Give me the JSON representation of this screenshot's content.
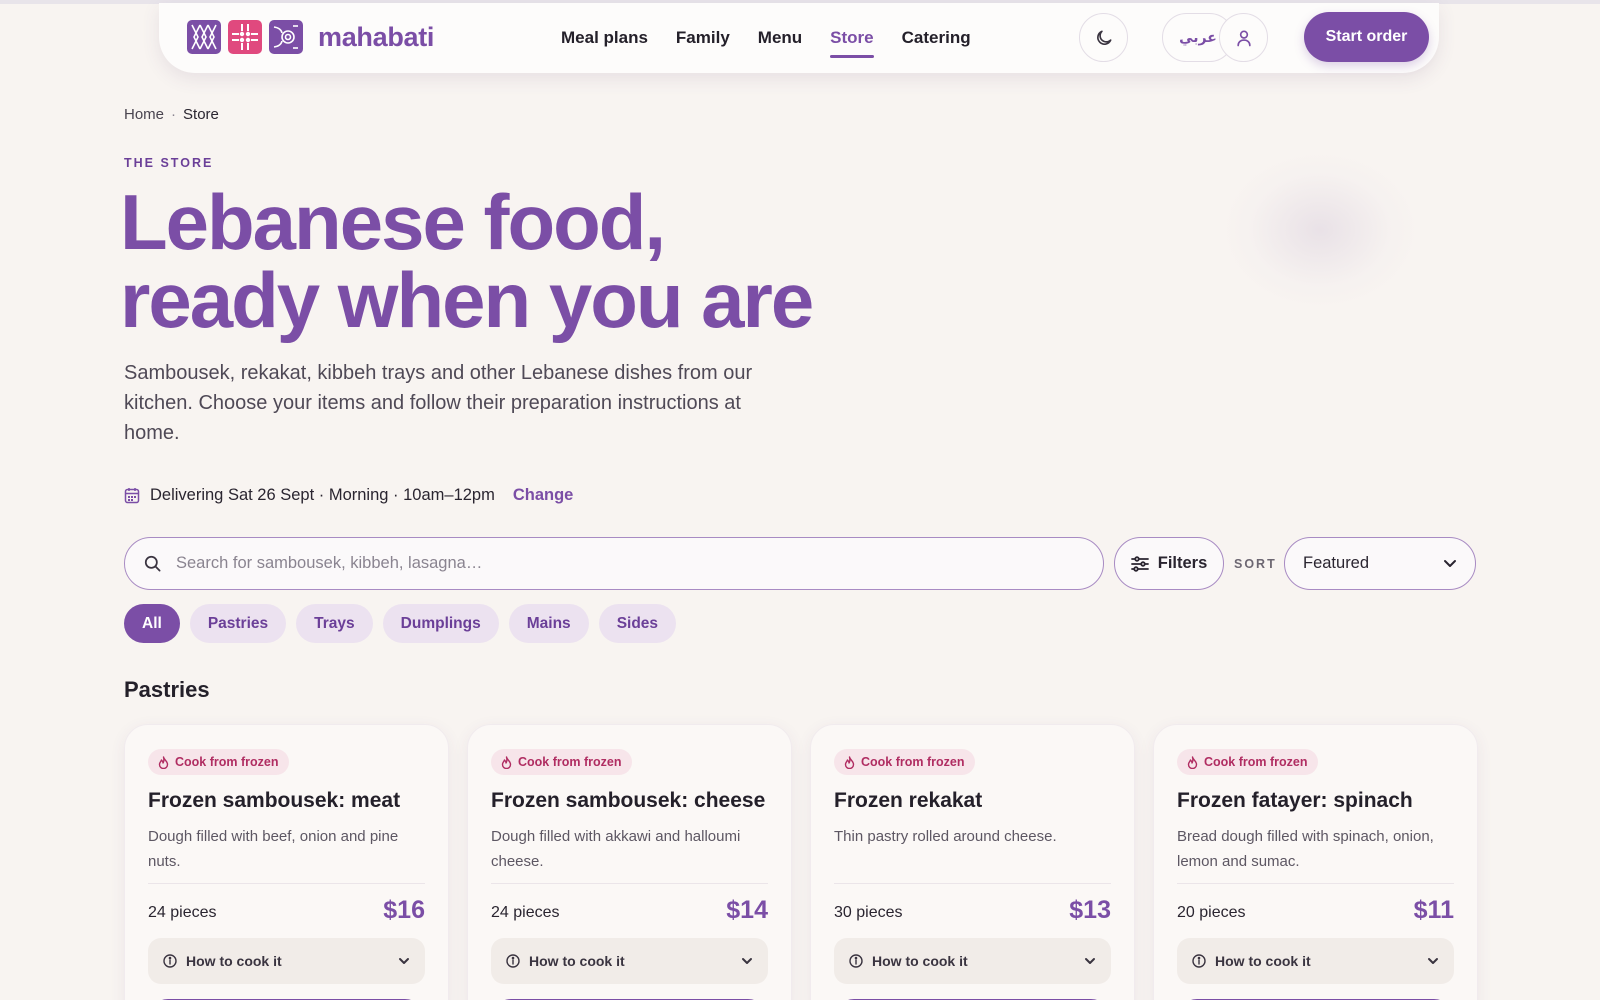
{
  "header": {
    "brand": "mahabati",
    "nav": [
      {
        "label": "Meal plans",
        "active": false
      },
      {
        "label": "Family",
        "active": false
      },
      {
        "label": "Menu",
        "active": false
      },
      {
        "label": "Store",
        "active": true
      },
      {
        "label": "Catering",
        "active": false
      }
    ],
    "theme_icon": "moon-icon",
    "language_label": "عربي",
    "account_icon": "user-icon",
    "cta_label": "Start order"
  },
  "breadcrumb": {
    "home": "Home",
    "separator": "·",
    "current": "Store"
  },
  "hero": {
    "eyebrow": "THE STORE",
    "title_line1": "Lebanese food,",
    "title_line2": "ready when you are",
    "subtitle": "Sambousek, rekakat, kibbeh trays and other Lebanese dishes from our kitchen. Choose your items and follow their preparation instructions at home."
  },
  "delivery": {
    "icon": "calendar-icon",
    "text": "Delivering Sat 26 Sept · Morning · 10am–12pm",
    "change_label": "Change"
  },
  "search": {
    "placeholder": "Search for sambousek, kibbeh, lasagna…",
    "value": ""
  },
  "filters": {
    "label": "Filters",
    "icon": "sliders-icon"
  },
  "sort": {
    "label": "SORT",
    "selected": "Featured"
  },
  "categories": [
    {
      "label": "All",
      "active": true
    },
    {
      "label": "Pastries",
      "active": false
    },
    {
      "label": "Trays",
      "active": false
    },
    {
      "label": "Dumplings",
      "active": false
    },
    {
      "label": "Mains",
      "active": false
    },
    {
      "label": "Sides",
      "active": false
    }
  ],
  "section_title": "Pastries",
  "products": [
    {
      "badge": "Cook from frozen",
      "name": "Frozen sambousek: meat",
      "description": "Dough filled with beef, onion and pine nuts.",
      "quantity": "24 pieces",
      "price": "$16",
      "howto": "How to cook it"
    },
    {
      "badge": "Cook from frozen",
      "name": "Frozen sambousek: cheese",
      "description": "Dough filled with akkawi and halloumi cheese.",
      "quantity": "24 pieces",
      "price": "$14",
      "howto": "How to cook it"
    },
    {
      "badge": "Cook from frozen",
      "name": "Frozen rekakat",
      "description": "Thin pastry rolled around cheese.",
      "quantity": "30 pieces",
      "price": "$13",
      "howto": "How to cook it"
    },
    {
      "badge": "Cook from frozen",
      "name": "Frozen fatayer: spinach",
      "description": "Bread dough filled with spinach, onion, lemon and sumac.",
      "quantity": "20 pieces",
      "price": "$11",
      "howto": "How to cook it"
    }
  ],
  "colors": {
    "accent": "#7b4ea6",
    "background": "#f8f4f1",
    "badge": "#b02d62",
    "logo_pink": "#e0497e"
  }
}
